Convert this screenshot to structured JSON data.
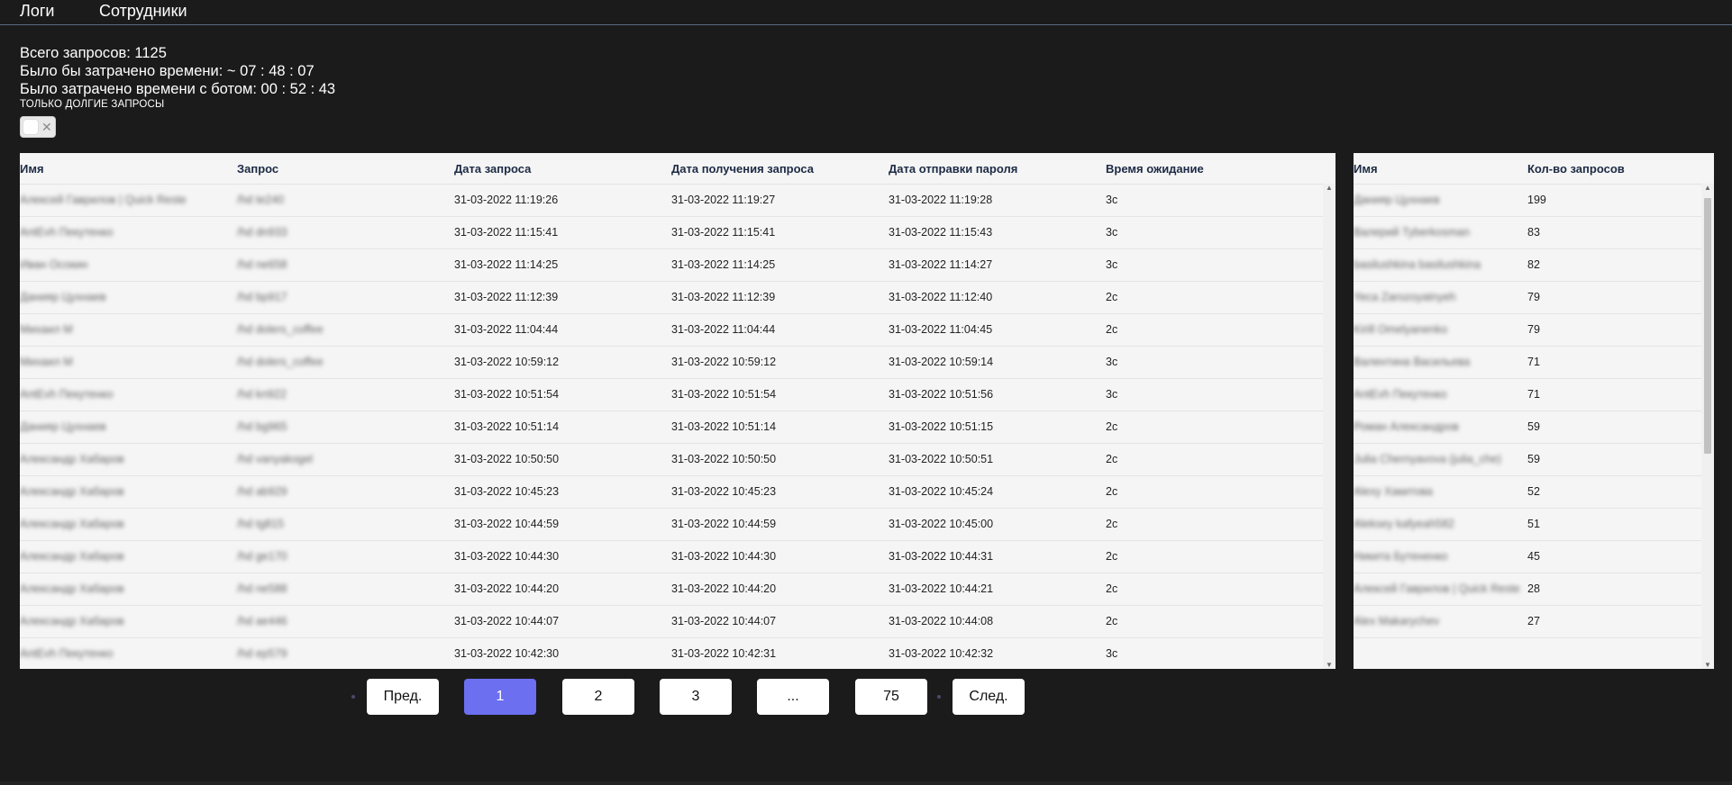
{
  "nav": {
    "logs": "Логи",
    "employees": "Сотрудники"
  },
  "stats": {
    "total": "Всего запросов: 1125",
    "would_spend": "Было бы затрачено времени: ~ 07 : 48 : 07",
    "spent_with_bot": "Было затрачено времени с ботом: 00 : 52 : 43"
  },
  "filter": {
    "label": "ТОЛЬКО ДОЛГИЕ ЗАПРОСЫ",
    "long_only": false
  },
  "main_table": {
    "headers": [
      "Имя",
      "Запрос",
      "Дата запроса",
      "Дата получения запроса",
      "Дата отправки пароля",
      "Время ожидание"
    ],
    "rows": [
      [
        "Алексей Гаврилов | Quick Reste",
        "/hd te240",
        "31-03-2022 11:19:26",
        "31-03-2022 11:19:27",
        "31-03-2022 11:19:28",
        "3с"
      ],
      [
        "AntEvh Пекутенко",
        "/hd dn933",
        "31-03-2022 11:15:41",
        "31-03-2022 11:15:41",
        "31-03-2022 11:15:43",
        "3с"
      ],
      [
        "Иван Осокин",
        "/hd ne658",
        "31-03-2022 11:14:25",
        "31-03-2022 11:14:25",
        "31-03-2022 11:14:27",
        "3с"
      ],
      [
        "Данияр Цухнаев",
        "/hd bp917",
        "31-03-2022 11:12:39",
        "31-03-2022 11:12:39",
        "31-03-2022 11:12:40",
        "2с"
      ],
      [
        "Михаил М",
        "/hd dolers_coffee",
        "31-03-2022 11:04:44",
        "31-03-2022 11:04:44",
        "31-03-2022 11:04:45",
        "2с"
      ],
      [
        "Михаил М",
        "/hd dolers_coffee",
        "31-03-2022 10:59:12",
        "31-03-2022 10:59:12",
        "31-03-2022 10:59:14",
        "3с"
      ],
      [
        "AntEvh Пекутенко",
        "/hd kn922",
        "31-03-2022 10:51:54",
        "31-03-2022 10:51:54",
        "31-03-2022 10:51:56",
        "3с"
      ],
      [
        "Данияр Цухнаев",
        "/hd bg965",
        "31-03-2022 10:51:14",
        "31-03-2022 10:51:14",
        "31-03-2022 10:51:15",
        "2с"
      ],
      [
        "Александр Хабаров",
        "/hd vanyakogel",
        "31-03-2022 10:50:50",
        "31-03-2022 10:50:50",
        "31-03-2022 10:50:51",
        "2с"
      ],
      [
        "Александр Хабаров",
        "/hd ab929",
        "31-03-2022 10:45:23",
        "31-03-2022 10:45:23",
        "31-03-2022 10:45:24",
        "2с"
      ],
      [
        "Александр Хабаров",
        "/hd tg815",
        "31-03-2022 10:44:59",
        "31-03-2022 10:44:59",
        "31-03-2022 10:45:00",
        "2с"
      ],
      [
        "Александр Хабаров",
        "/hd ge170",
        "31-03-2022 10:44:30",
        "31-03-2022 10:44:30",
        "31-03-2022 10:44:31",
        "2с"
      ],
      [
        "Александр Хабаров",
        "/hd ne588",
        "31-03-2022 10:44:20",
        "31-03-2022 10:44:20",
        "31-03-2022 10:44:21",
        "2с"
      ],
      [
        "Александр Хабаров",
        "/hd ae446",
        "31-03-2022 10:44:07",
        "31-03-2022 10:44:07",
        "31-03-2022 10:44:08",
        "2с"
      ],
      [
        "AntEvh Пекутенко",
        "/hd ep579",
        "31-03-2022 10:42:30",
        "31-03-2022 10:42:31",
        "31-03-2022 10:42:32",
        "3с"
      ]
    ]
  },
  "side_table": {
    "headers": [
      "Имя",
      "Кол-во запросов"
    ],
    "rows": [
      [
        "Данияр Цухнаев",
        "199"
      ],
      [
        "Валерий Tyberkosman",
        "83"
      ],
      [
        "basilushkina basilushkina",
        "82"
      ],
      [
        "Yeca Zarozoyatnyeh",
        "79"
      ],
      [
        "Kirill Omelyanenko",
        "79"
      ],
      [
        "Валентина Васильева",
        "71"
      ],
      [
        "AntEvh Пекутенко",
        "71"
      ],
      [
        "Роман Александров",
        "59"
      ],
      [
        "Julia Chernyavova (julia_che)",
        "59"
      ],
      [
        "Alexy Хакитова",
        "52"
      ],
      [
        "Aleksey kafyeah582",
        "51"
      ],
      [
        "Никита Бутененко",
        "45"
      ],
      [
        "Алексей Гаврилов | Quick Reste",
        "28"
      ],
      [
        "Alex Makarychev",
        "27"
      ]
    ]
  },
  "pagination": {
    "prev": "Пред.",
    "pages": [
      "1",
      "2",
      "3",
      "...",
      "75"
    ],
    "active": "1",
    "next": "След."
  },
  "colors": {
    "background": "#1b1b1b",
    "accent": "#6b6ff0",
    "panel": "#f5f5f5"
  }
}
